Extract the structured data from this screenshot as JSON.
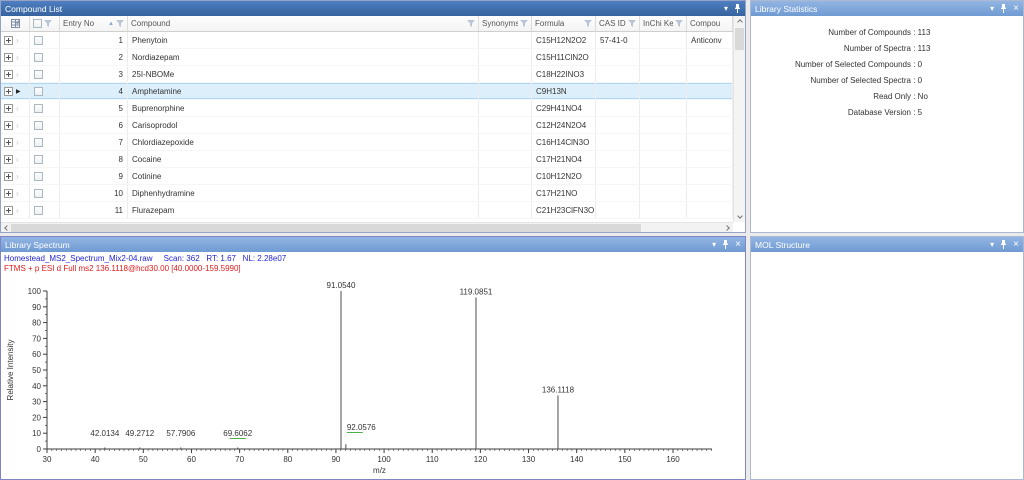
{
  "icons": {
    "dropdown": "▾",
    "close": "×",
    "sort_asc": "▲",
    "row_chevron": "›",
    "current_row_marker": "▶"
  },
  "panels": {
    "compound_list": {
      "title": "Compound List",
      "columns": [
        {
          "label": ""
        },
        {
          "label": ""
        },
        {
          "label": "Entry No",
          "sorted": "asc",
          "filter": true
        },
        {
          "label": "Compound",
          "filter": true
        },
        {
          "label": "Synonyms",
          "filter": true
        },
        {
          "label": "Formula",
          "filter": true
        },
        {
          "label": "CAS ID",
          "filter": true
        },
        {
          "label": "InChi Key",
          "filter": true
        },
        {
          "label": "Compou",
          "filter": false
        }
      ],
      "rows": [
        {
          "entry": "1",
          "compound": "Phenytoin",
          "synonyms": "",
          "formula": "C15H12N2O2",
          "cas": "57-41-0",
          "inchi": "",
          "cls": "Anticonv",
          "current": false
        },
        {
          "entry": "2",
          "compound": "Nordiazepam",
          "synonyms": "",
          "formula": "C15H11ClN2O",
          "cas": "",
          "inchi": "",
          "cls": "",
          "current": false
        },
        {
          "entry": "3",
          "compound": "25I-NBOMe",
          "synonyms": "",
          "formula": "C18H22INO3",
          "cas": "",
          "inchi": "",
          "cls": "",
          "current": false
        },
        {
          "entry": "4",
          "compound": "Amphetamine",
          "synonyms": "",
          "formula": "C9H13N",
          "cas": "",
          "inchi": "",
          "cls": "",
          "current": true
        },
        {
          "entry": "5",
          "compound": "Buprenorphine",
          "synonyms": "",
          "formula": "C29H41NO4",
          "cas": "",
          "inchi": "",
          "cls": "",
          "current": false
        },
        {
          "entry": "6",
          "compound": "Carisoprodol",
          "synonyms": "",
          "formula": "C12H24N2O4",
          "cas": "",
          "inchi": "",
          "cls": "",
          "current": false
        },
        {
          "entry": "7",
          "compound": "Chlordiazepoxide",
          "synonyms": "",
          "formula": "C16H14ClN3O",
          "cas": "",
          "inchi": "",
          "cls": "",
          "current": false
        },
        {
          "entry": "8",
          "compound": "Cocaine",
          "synonyms": "",
          "formula": "C17H21NO4",
          "cas": "",
          "inchi": "",
          "cls": "",
          "current": false
        },
        {
          "entry": "9",
          "compound": "Cotinine",
          "synonyms": "",
          "formula": "C10H12N2O",
          "cas": "",
          "inchi": "",
          "cls": "",
          "current": false
        },
        {
          "entry": "10",
          "compound": "Diphenhydramine",
          "synonyms": "",
          "formula": "C17H21NO",
          "cas": "",
          "inchi": "",
          "cls": "",
          "current": false
        },
        {
          "entry": "11",
          "compound": "Flurazepam",
          "synonyms": "",
          "formula": "C21H23ClFN3O",
          "cas": "",
          "inchi": "",
          "cls": "",
          "current": false
        }
      ]
    },
    "library_statistics": {
      "title": "Library Statistics",
      "separator": " : ",
      "stats": [
        {
          "label": "Number of Compounds",
          "value": "113"
        },
        {
          "label": "Number of Spectra",
          "value": "113"
        },
        {
          "label": "Number of Selected Compounds",
          "value": "0"
        },
        {
          "label": "Number of Selected Spectra",
          "value": "0"
        },
        {
          "label": "Read Only",
          "value": "No"
        },
        {
          "label": "Database Version",
          "value": "5"
        }
      ]
    },
    "library_spectrum": {
      "title": "Library Spectrum",
      "header_line1": "Homestead_MS2_Spectrum_Mix2-04.raw     Scan: 362   RT: 1.67   NL: 2.28e07",
      "header_line2": "FTMS + p ESI d Full ms2 136.1118@hcd30.00 [40.0000-159.5990]"
    },
    "mol_structure": {
      "title": "MOL Structure"
    }
  },
  "chart_data": {
    "type": "bar",
    "title": "",
    "xlabel": "m/z",
    "ylabel": "Relative Intensity",
    "xlim": [
      30,
      168.6
    ],
    "ylim": [
      0,
      100
    ],
    "x_ticks": [
      30,
      40,
      50,
      60,
      70,
      80,
      90,
      100,
      110,
      120,
      130,
      140,
      150,
      160
    ],
    "y_ticks": [
      0,
      10,
      20,
      30,
      40,
      50,
      60,
      70,
      80,
      90,
      100
    ],
    "legend": "none",
    "grid": false,
    "peaks": [
      {
        "mz": 42.0134,
        "intensity": 1,
        "label": "42.0134"
      },
      {
        "mz": 49.2712,
        "intensity": 1,
        "label": "49.2712"
      },
      {
        "mz": 57.7906,
        "intensity": 1,
        "label": "57.7906"
      },
      {
        "mz": 69.6062,
        "intensity": 1,
        "label": "69.6062",
        "underline": true
      },
      {
        "mz": 91.054,
        "intensity": 100,
        "label": "91.0540"
      },
      {
        "mz": 92.0576,
        "intensity": 3,
        "label": "92.0576",
        "underline": true,
        "label_align": "start",
        "label_dy": -6
      },
      {
        "mz": 119.0851,
        "intensity": 96,
        "label": "119.0851"
      },
      {
        "mz": 136.1118,
        "intensity": 34,
        "label": "136.1118"
      }
    ]
  }
}
